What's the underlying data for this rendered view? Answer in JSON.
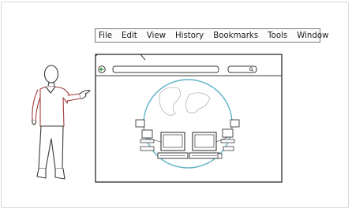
{
  "menu": {
    "items": [
      "File",
      "Edit",
      "View",
      "History",
      "Bookmarks",
      "Tools",
      "Window"
    ]
  },
  "colors": {
    "ink": "#3a3a3a",
    "shirt": "#a23b3b",
    "globe": "#5fb3c8",
    "frame_border": "#d9d9d9",
    "menu_border": "#7a7a7a"
  },
  "icons": {
    "back": "back-arrow-icon",
    "search": "magnifier-icon"
  }
}
